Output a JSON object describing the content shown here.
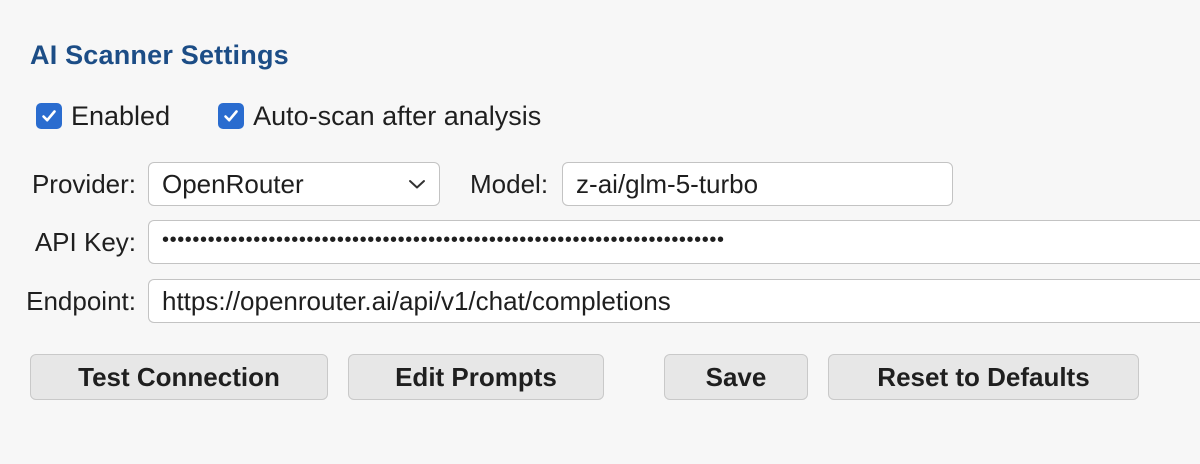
{
  "section": {
    "title": "AI Scanner Settings"
  },
  "checkboxes": [
    {
      "label": "Enabled",
      "checked": true
    },
    {
      "label": "Auto-scan after analysis",
      "checked": true
    }
  ],
  "form": {
    "provider_label": "Provider:",
    "provider_value": "OpenRouter",
    "model_label": "Model:",
    "model_value": "z-ai/glm-5-turbo",
    "api_key_label": "API Key:",
    "api_key_masked": "••••••••••••••••••••••••••••••••••••••••••••••••••••••••••••••••••••••••••",
    "endpoint_label": "Endpoint:",
    "endpoint_value": "https://openrouter.ai/api/v1/chat/completions"
  },
  "buttons": {
    "test_connection": "Test Connection",
    "edit_prompts": "Edit Prompts",
    "save": "Save",
    "reset_defaults": "Reset to Defaults"
  },
  "icons": {
    "checkbox": "checkmark-icon",
    "dropdown": "chevron-down-icon"
  },
  "colors": {
    "title": "#1c4d86",
    "checkbox_fill": "#2a6ccf",
    "background": "#f7f7f7",
    "button_bg": "#e7e7e7"
  }
}
